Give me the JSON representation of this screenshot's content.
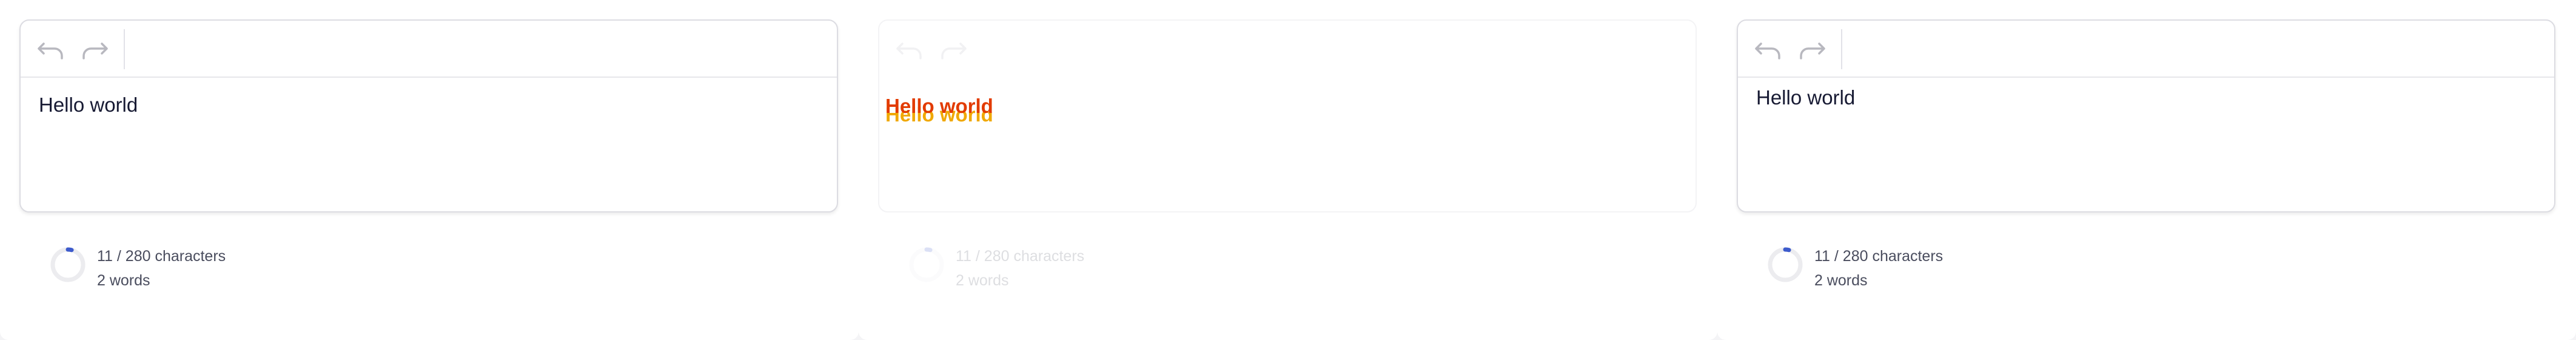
{
  "toolbar": {
    "undo_icon": "undo-icon",
    "redo_icon": "redo-icon"
  },
  "editor": {
    "content": "Hello world"
  },
  "footer": {
    "characters": "11 / 280 characters",
    "words": "2 words",
    "character_count": 11,
    "character_limit": 280,
    "ring_fill_fraction": 0.039
  },
  "colors": {
    "text": "#171a33",
    "border": "#dcdce2",
    "icon": "#b8b8bf",
    "ring_track": "#ececef",
    "ring_fill": "#3d5bcc",
    "ghost_red": "#e23b00",
    "ghost_yellow": "#f0a800"
  }
}
